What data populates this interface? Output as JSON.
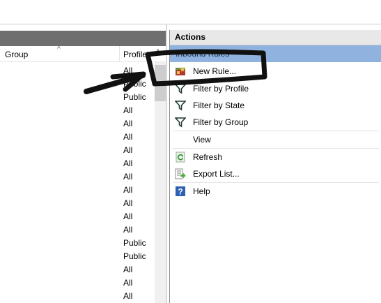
{
  "left_pane": {
    "columns": {
      "group": "Group",
      "profile": "Profile"
    },
    "rows": [
      "All",
      "Public",
      "Public",
      "All",
      "All",
      "All",
      "All",
      "All",
      "All",
      "All",
      "All",
      "All",
      "All",
      "Public",
      "Public",
      "All",
      "All",
      "All"
    ]
  },
  "actions": {
    "title": "Actions",
    "section": "Inbound Rules",
    "items": [
      {
        "label": "New Rule...",
        "icon": "new-rule-icon"
      },
      {
        "label": "Filter by Profile",
        "icon": "filter-icon"
      },
      {
        "label": "Filter by State",
        "icon": "filter-icon"
      },
      {
        "label": "Filter by Group",
        "icon": "filter-icon"
      },
      {
        "label": "View",
        "icon": ""
      },
      {
        "label": "Refresh",
        "icon": "refresh-icon"
      },
      {
        "label": "Export List...",
        "icon": "export-icon"
      },
      {
        "label": "Help",
        "icon": "help-icon"
      }
    ]
  }
}
